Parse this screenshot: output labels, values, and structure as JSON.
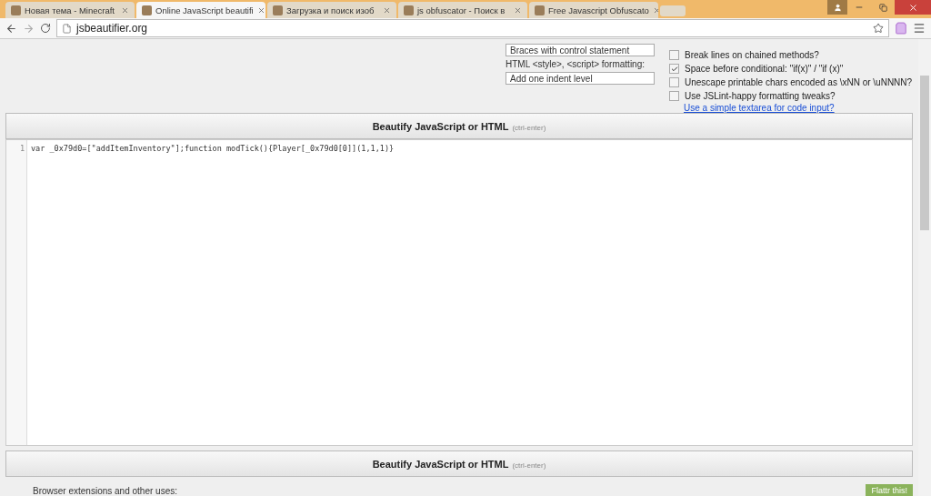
{
  "tabs": [
    {
      "title": "Новая тема - Minecraft",
      "selected": false
    },
    {
      "title": "Online JavaScript beautifi",
      "selected": true
    },
    {
      "title": "Загрузка и поиск изоб",
      "selected": false
    },
    {
      "title": "js obfuscator - Поиск в",
      "selected": false
    },
    {
      "title": "Free Javascript Obfuscato",
      "selected": false
    }
  ],
  "address_bar": {
    "value": "jsbeautifier.org"
  },
  "settings": {
    "brace_select": "Braces with control statement",
    "html_label": "HTML <style>, <script> formatting:",
    "html_select": "Add one indent level",
    "options": [
      {
        "label": "Break lines on chained methods?",
        "checked": false
      },
      {
        "label": "Space before conditional: \"if(x)\" / \"if (x)\"",
        "checked": true
      },
      {
        "label": "Unescape printable chars encoded as \\xNN or \\uNNNN?",
        "checked": false
      },
      {
        "label": "Use JSLint-happy formatting tweaks?",
        "checked": false
      }
    ],
    "link": "Use a simple textarea for code input?"
  },
  "beautify_button": {
    "label": "Beautify JavaScript or HTML",
    "hint": "(ctrl-enter)"
  },
  "editor": {
    "lines": [
      {
        "number": "1",
        "code": "var _0x79d0=[\"addItemInventory\"];function modTick(){Player[_0x79d0[0]](1,1,1)}"
      }
    ]
  },
  "beautify_button_bottom": {
    "label": "Beautify JavaScript or HTML",
    "hint": "(ctrl-enter)"
  },
  "footer": {
    "text": "Browser extensions and other uses:",
    "flattr": "Flattr this!"
  }
}
